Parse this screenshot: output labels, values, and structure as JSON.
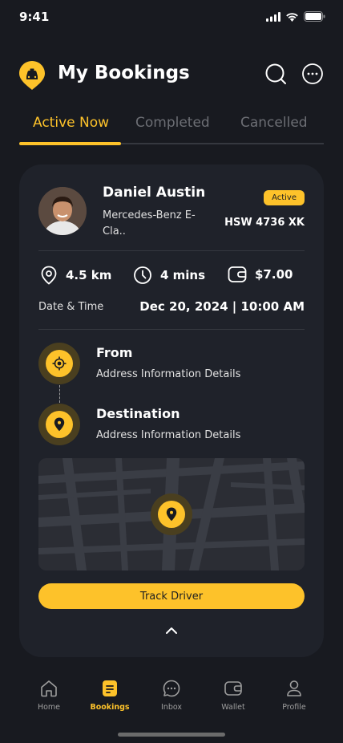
{
  "status": {
    "time": "9:41"
  },
  "header": {
    "title": "My Bookings"
  },
  "tabs": [
    {
      "label": "Active Now",
      "active": true
    },
    {
      "label": "Completed",
      "active": false
    },
    {
      "label": "Cancelled",
      "active": false
    }
  ],
  "booking": {
    "driver_name": "Daniel Austin",
    "car_model": "Mercedes-Benz E-Cla..",
    "status_badge": "Active",
    "plate": "HSW 4736 XK",
    "distance": "4.5 km",
    "duration": "4 mins",
    "price": "$7.00",
    "datetime_label": "Date & Time",
    "datetime_value": "Dec 20, 2024 | 10:00 AM",
    "from_title": "From",
    "from_address": "Address Information Details",
    "destination_title": "Destination",
    "destination_address": "Address Information Details",
    "track_button": "Track Driver"
  },
  "nav": [
    {
      "label": "Home",
      "icon": "home-icon",
      "active": false
    },
    {
      "label": "Bookings",
      "icon": "bookings-icon",
      "active": true
    },
    {
      "label": "Inbox",
      "icon": "chat-icon",
      "active": false
    },
    {
      "label": "Wallet",
      "icon": "wallet-icon",
      "active": false
    },
    {
      "label": "Profile",
      "icon": "profile-icon",
      "active": false
    }
  ],
  "colors": {
    "accent": "#FDC22A",
    "background": "#181A20",
    "card": "#1F222A",
    "divider": "#35383F"
  }
}
